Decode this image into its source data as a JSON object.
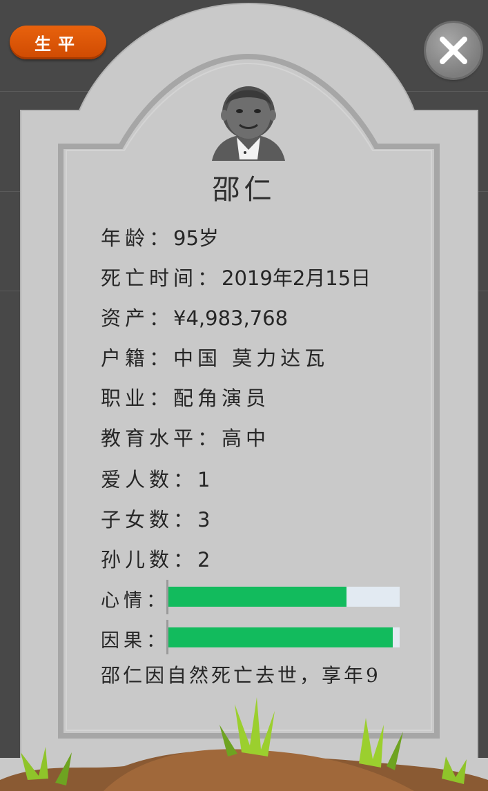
{
  "header": {
    "life_button_label": "生平",
    "close_icon": "close-x-icon"
  },
  "profile": {
    "name": "邵仁",
    "avatar": "elderly-man-avatar"
  },
  "details": [
    {
      "label": "年龄：",
      "value": "95",
      "suffix": "岁"
    },
    {
      "label": "死亡时间：",
      "value": "2019年2月15日",
      "suffix": ""
    },
    {
      "label": "资产：",
      "value": "¥4,983,768",
      "suffix": ""
    },
    {
      "label": "户籍：",
      "value": "中国 莫力达瓦",
      "suffix": ""
    },
    {
      "label": "职业：",
      "value": "配角演员",
      "suffix": ""
    },
    {
      "label": "教育水平：",
      "value": "高中",
      "suffix": ""
    },
    {
      "label": "爱人数：",
      "value": "1",
      "suffix": ""
    },
    {
      "label": "子女数：",
      "value": "3",
      "suffix": ""
    },
    {
      "label": "孙儿数：",
      "value": "2",
      "suffix": ""
    }
  ],
  "bars": [
    {
      "label": "心情：",
      "fraction": 0.77,
      "color": "#12bb5d"
    },
    {
      "label": "因果：",
      "fraction": 0.97,
      "color": "#12bb5d"
    }
  ],
  "summary": "邵仁因自然死亡去世，享年9",
  "colors": {
    "background": "#484848",
    "tombstone": "#c9c9c9",
    "button_orange": "#dd5505",
    "bar_green": "#12bb5d",
    "bar_track": "#e2eaf2"
  }
}
